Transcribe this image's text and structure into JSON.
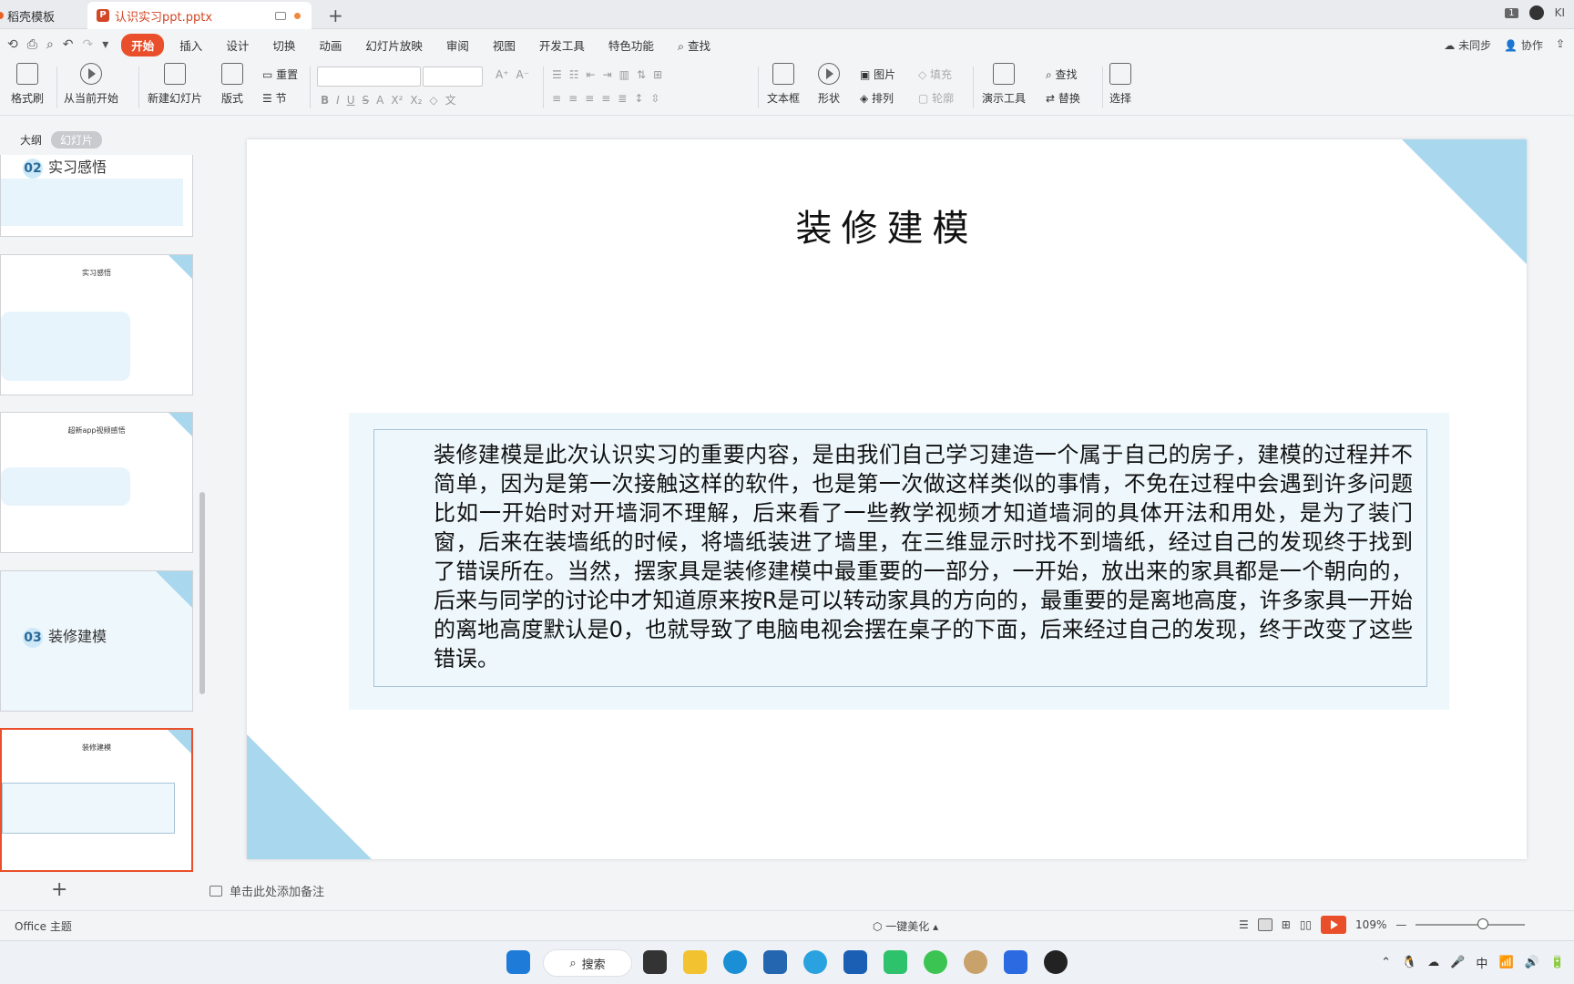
{
  "titlebar": {
    "tabs": [
      {
        "label": "稻壳模板"
      },
      {
        "label": "认识实习ppt.pptx"
      }
    ],
    "new_tab": "+",
    "badge": "1",
    "user": "KI"
  },
  "menu": {
    "items": [
      "开始",
      "插入",
      "设计",
      "切换",
      "动画",
      "幻灯片放映",
      "审阅",
      "视图",
      "开发工具",
      "特色功能"
    ],
    "search": "查找",
    "right": [
      "未同步",
      "协作"
    ]
  },
  "ribbon": {
    "format_painter": "格式刷",
    "from_current": "从当前开始",
    "new_slide": "新建幻灯片",
    "layout": "版式",
    "reset": "重置",
    "section": "节",
    "textbox": "文本框",
    "shape": "形状",
    "picture": "图片",
    "fill": "填充",
    "arrange": "排列",
    "outline": "轮廓",
    "presentation_tools": "演示工具",
    "find": "查找",
    "replace": "替换",
    "select": "选择"
  },
  "panel": {
    "tabs": [
      "大纲",
      "幻灯片"
    ],
    "thumbs": [
      {
        "num": "02",
        "title": "实习感悟"
      },
      {
        "title": "实习感悟"
      },
      {
        "title": "超新app视频感悟"
      },
      {
        "num": "03",
        "title": "装修建模"
      },
      {
        "title": "装修建模"
      }
    ]
  },
  "slide": {
    "title": "装修建模",
    "body": "装修建模是此次认识实习的重要内容，是由我们自己学习建造一个属于自己的房子，建模的过程并不简单，因为是第一次接触这样的软件，也是第一次做这样类似的事情，不免在过程中会遇到许多问题比如一开始时对开墙洞不理解，后来看了一些教学视频才知道墙洞的具体开法和用处，是为了装门窗，后来在装墙纸的时候，将墙纸装进了墙里，在三维显示时找不到墙纸，经过自己的发现终于找到了错误所在。当然，摆家具是装修建模中最重要的一部分，一开始，放出来的家具都是一个朝向的，后来与同学的讨论中才知道原来按R是可以转动家具的方向的，最重要的是离地高度，许多家具一开始的离地高度默认是0，也就导致了电脑电视会摆在桌子的下面，后来经过自己的发现，终于改变了这些错误。"
  },
  "notes": {
    "placeholder": "单击此处添加备注"
  },
  "status": {
    "theme": "Office 主题",
    "beautify": "一键美化",
    "zoom": "109%"
  },
  "taskbar": {
    "search": "搜索",
    "ime": "中"
  },
  "colors": {
    "accent": "#e94f2a",
    "slide_corner": "#a9d8ee",
    "panel_bg": "#eef7fc"
  }
}
